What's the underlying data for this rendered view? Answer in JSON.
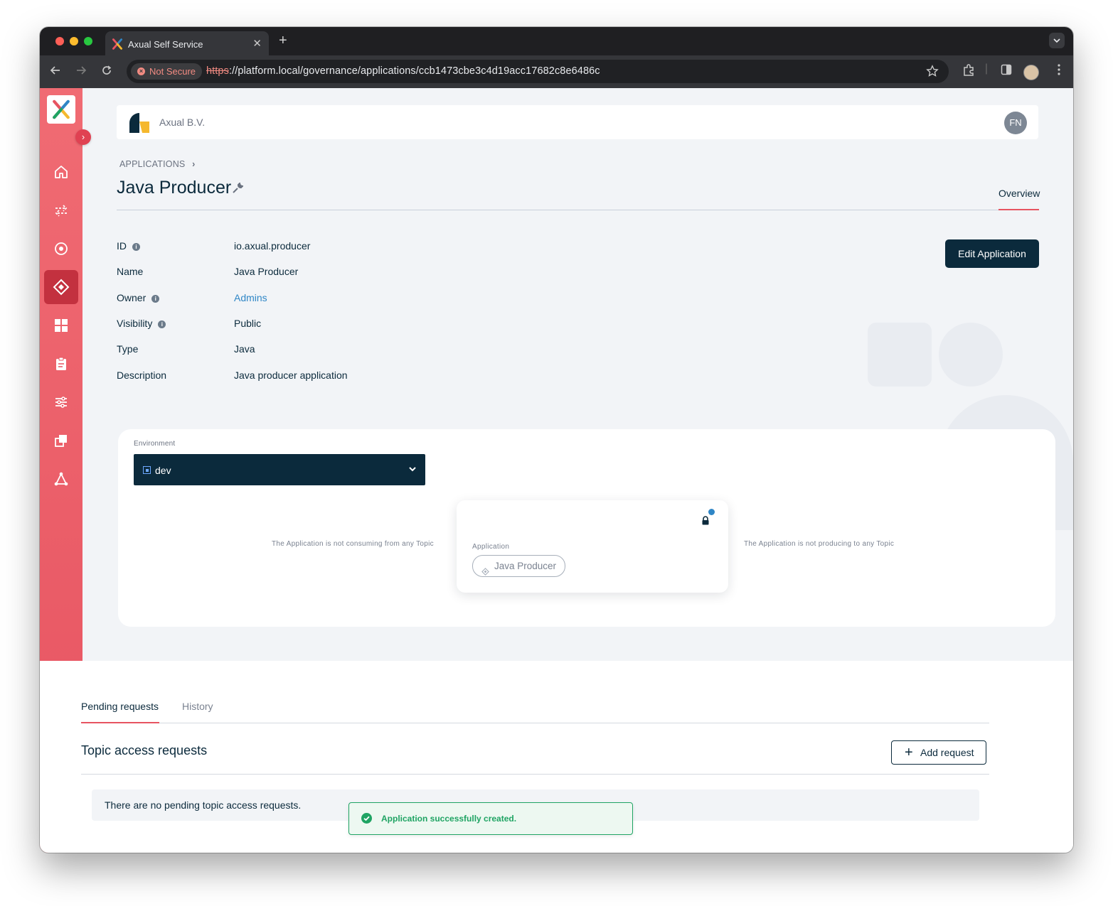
{
  "browser": {
    "tab_title": "Axual Self Service",
    "tab_close": "✕",
    "new_tab": "+",
    "not_secure": "Not Secure",
    "url_scheme": "https",
    "url_rest": "://platform.local/governance/applications/ccb1473cbe3c4d19acc17682c8e6486c"
  },
  "header": {
    "org_name": "Axual B.V.",
    "avatar_initials": "FN"
  },
  "page": {
    "breadcrumb": "APPLICATIONS",
    "title": "Java Producer",
    "tab_overview": "Overview",
    "edit_button": "Edit Application"
  },
  "properties": [
    {
      "label": "ID",
      "value": "io.axual.producer"
    },
    {
      "label": "Name",
      "value": "Java Producer"
    },
    {
      "label": "Owner",
      "value": "Admins"
    },
    {
      "label": "Visibility",
      "value": "Public"
    },
    {
      "label": "Type",
      "value": "Java"
    },
    {
      "label": "Description",
      "value": "Java producer application"
    }
  ],
  "environment": {
    "label": "Environment",
    "selected": "dev",
    "consuming_message": "The Application is not consuming from any Topic",
    "producing_message": "The Application is not producing to any Topic",
    "app_card_label": "Application",
    "app_chip": "Java Producer"
  },
  "requests": {
    "tab_pending": "Pending requests",
    "tab_history": "History",
    "section_title": "Topic access requests",
    "add_button": "Add request",
    "empty_message": "There are no pending topic access requests."
  },
  "toast": {
    "message": "Application successfully created."
  },
  "colors": {
    "sidebar": "#e75461",
    "primary_dark": "#0b2a3c",
    "link": "#2f86c6",
    "success": "#1fa463"
  }
}
